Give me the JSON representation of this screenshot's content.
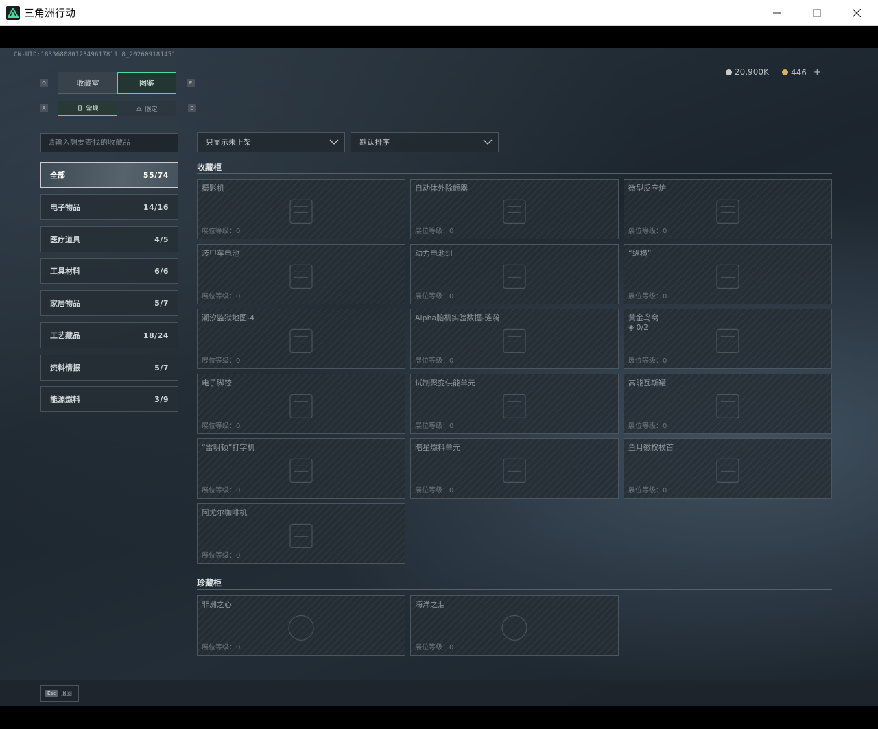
{
  "window": {
    "title": "三角洲行动"
  },
  "uid": "CN-UID:18336808012349617811 8_202609181451",
  "currency": {
    "silver": "20,900K",
    "gold": "446",
    "add": "+"
  },
  "keys": {
    "left_tab": "Q",
    "right_tab": "E",
    "left_sub": "A",
    "right_sub": "D",
    "esc": "Esc"
  },
  "tabs": [
    {
      "label": "收藏室"
    },
    {
      "label": "图鉴"
    }
  ],
  "subtabs": [
    {
      "label": "常规"
    },
    {
      "label": "限定"
    }
  ],
  "search": {
    "placeholder": "请输入想要查找的收藏品"
  },
  "categories": [
    {
      "label": "全部",
      "count": "55/74"
    },
    {
      "label": "电子物品",
      "count": "14/16"
    },
    {
      "label": "医疗道具",
      "count": "4/5"
    },
    {
      "label": "工具材料",
      "count": "6/6"
    },
    {
      "label": "家居物品",
      "count": "5/7"
    },
    {
      "label": "工艺藏品",
      "count": "18/24"
    },
    {
      "label": "资料情报",
      "count": "5/7"
    },
    {
      "label": "能源燃料",
      "count": "3/9"
    }
  ],
  "filters": {
    "show": "只显示未上架",
    "sort": "默认排序"
  },
  "sections": {
    "cabinet": "收藏柜",
    "treasure": "珍藏柜"
  },
  "level_label": "展位等级：0",
  "items": [
    {
      "name": "摄影机"
    },
    {
      "name": "自动体外除颤器"
    },
    {
      "name": "微型反应炉"
    },
    {
      "name": "装甲车电池"
    },
    {
      "name": "动力电池组"
    },
    {
      "name": "“纵横”"
    },
    {
      "name": "潮汐监狱地图-4"
    },
    {
      "name": "Alpha脑机实验数据-涟漪"
    },
    {
      "name": "黄金鸟窝",
      "sub": "0/2"
    },
    {
      "name": "电子脚镣"
    },
    {
      "name": "试制聚变供能单元"
    },
    {
      "name": "高能瓦斯罐"
    },
    {
      "name": "“雷明顿”打字机"
    },
    {
      "name": "暗星燃料单元"
    },
    {
      "name": "鱼月徽权杖首"
    },
    {
      "name": "阿尤尔咖啡机"
    }
  ],
  "treasures": [
    {
      "name": "非洲之心"
    },
    {
      "name": "海洋之泪"
    }
  ],
  "footer": {
    "back": "退回"
  }
}
